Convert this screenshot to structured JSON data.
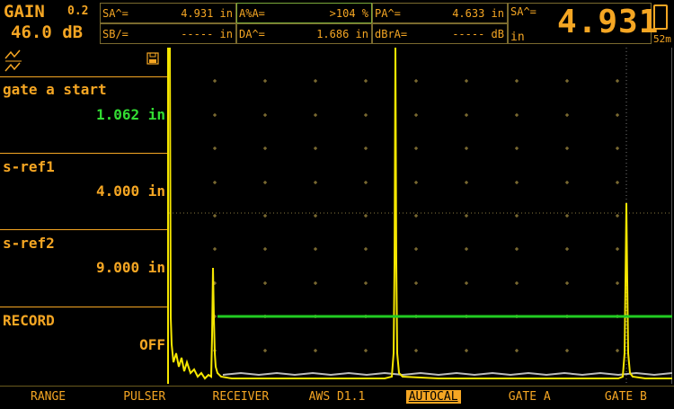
{
  "header": {
    "gain_label": "GAIN",
    "gain_step": "0.2",
    "gain_value": "46.0 dB",
    "readouts": [
      {
        "label": "SA^=",
        "value": "4.931 in"
      },
      {
        "label": "A%A=",
        "value": ">104 %"
      },
      {
        "label": "PA^=",
        "value": "4.633 in"
      },
      {
        "label": "SB/=",
        "value": "----- in"
      },
      {
        "label": "DA^=",
        "value": "1.686 in"
      },
      {
        "label": "dBrA=",
        "value": "----- dB"
      }
    ],
    "big_readout": {
      "label": "SA^=",
      "unit": "in",
      "value": "4.931"
    },
    "battery_text": "52m"
  },
  "panel": {
    "items": [
      {
        "label": "gate a start",
        "value": "1.062 in"
      },
      {
        "label": "s-ref1",
        "value": "4.000 in"
      },
      {
        "label": "s-ref2",
        "value": "9.000 in"
      },
      {
        "label": "RECORD",
        "value": "OFF"
      }
    ]
  },
  "colors": {
    "accent": "#f5a623",
    "signal": "#f5e600",
    "gate": "#22cc22",
    "highlight_value": "#33dd33"
  },
  "icons": {
    "top_left": "rectify-icon",
    "save": "floppy-disk-icon"
  },
  "softkeys": [
    {
      "label": "RANGE",
      "active": false
    },
    {
      "label": "PULSER",
      "active": false
    },
    {
      "label": "RECEIVER",
      "active": false
    },
    {
      "label": "AWS D1.1",
      "active": false
    },
    {
      "label": "AUTOCAL",
      "active": true
    },
    {
      "label": "GATE A",
      "active": false
    },
    {
      "label": "GATE B",
      "active": false
    }
  ]
}
